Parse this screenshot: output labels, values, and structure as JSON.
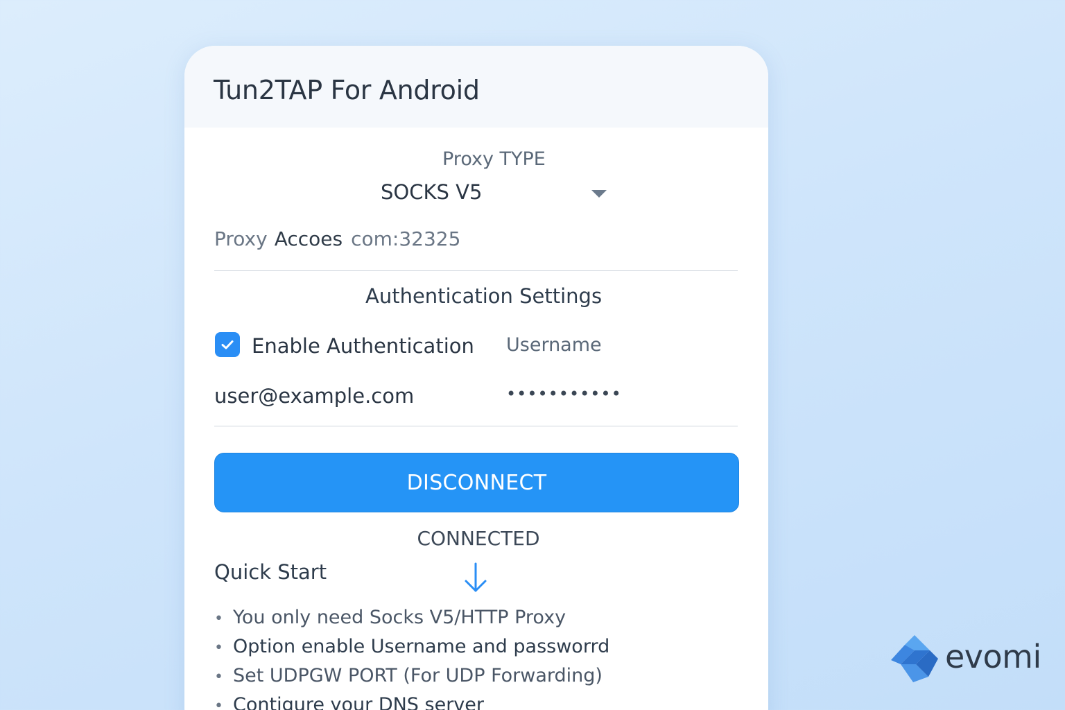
{
  "app": {
    "title": "Tun2TAP For Android"
  },
  "proxy": {
    "type_label": "Proxy TYPE",
    "type_value": "SOCKS V5",
    "address_label": "Proxy",
    "address_host": "Accoes",
    "address_port": "com:32325"
  },
  "auth": {
    "heading": "Authentication Settings",
    "enable_label": "Enable Authentication",
    "enabled": true,
    "username_label": "Username",
    "username_value": "user@example.com",
    "password_mask": "•••••••••••"
  },
  "connection": {
    "button_label": "DISCONNECT",
    "status": "CONNECTED"
  },
  "quick_start": {
    "heading": "Quick Start",
    "items": [
      "You only need Socks V5/HTTP Proxy",
      "Option enable Username and passworrd",
      "Set UDPGW PORT (For UDP Forwarding)",
      "Contigure your DNS server"
    ]
  },
  "brand": {
    "name": "evomi"
  },
  "colors": {
    "accent": "#2594f6",
    "background": "#d6eafb",
    "text": "#2a3543"
  }
}
